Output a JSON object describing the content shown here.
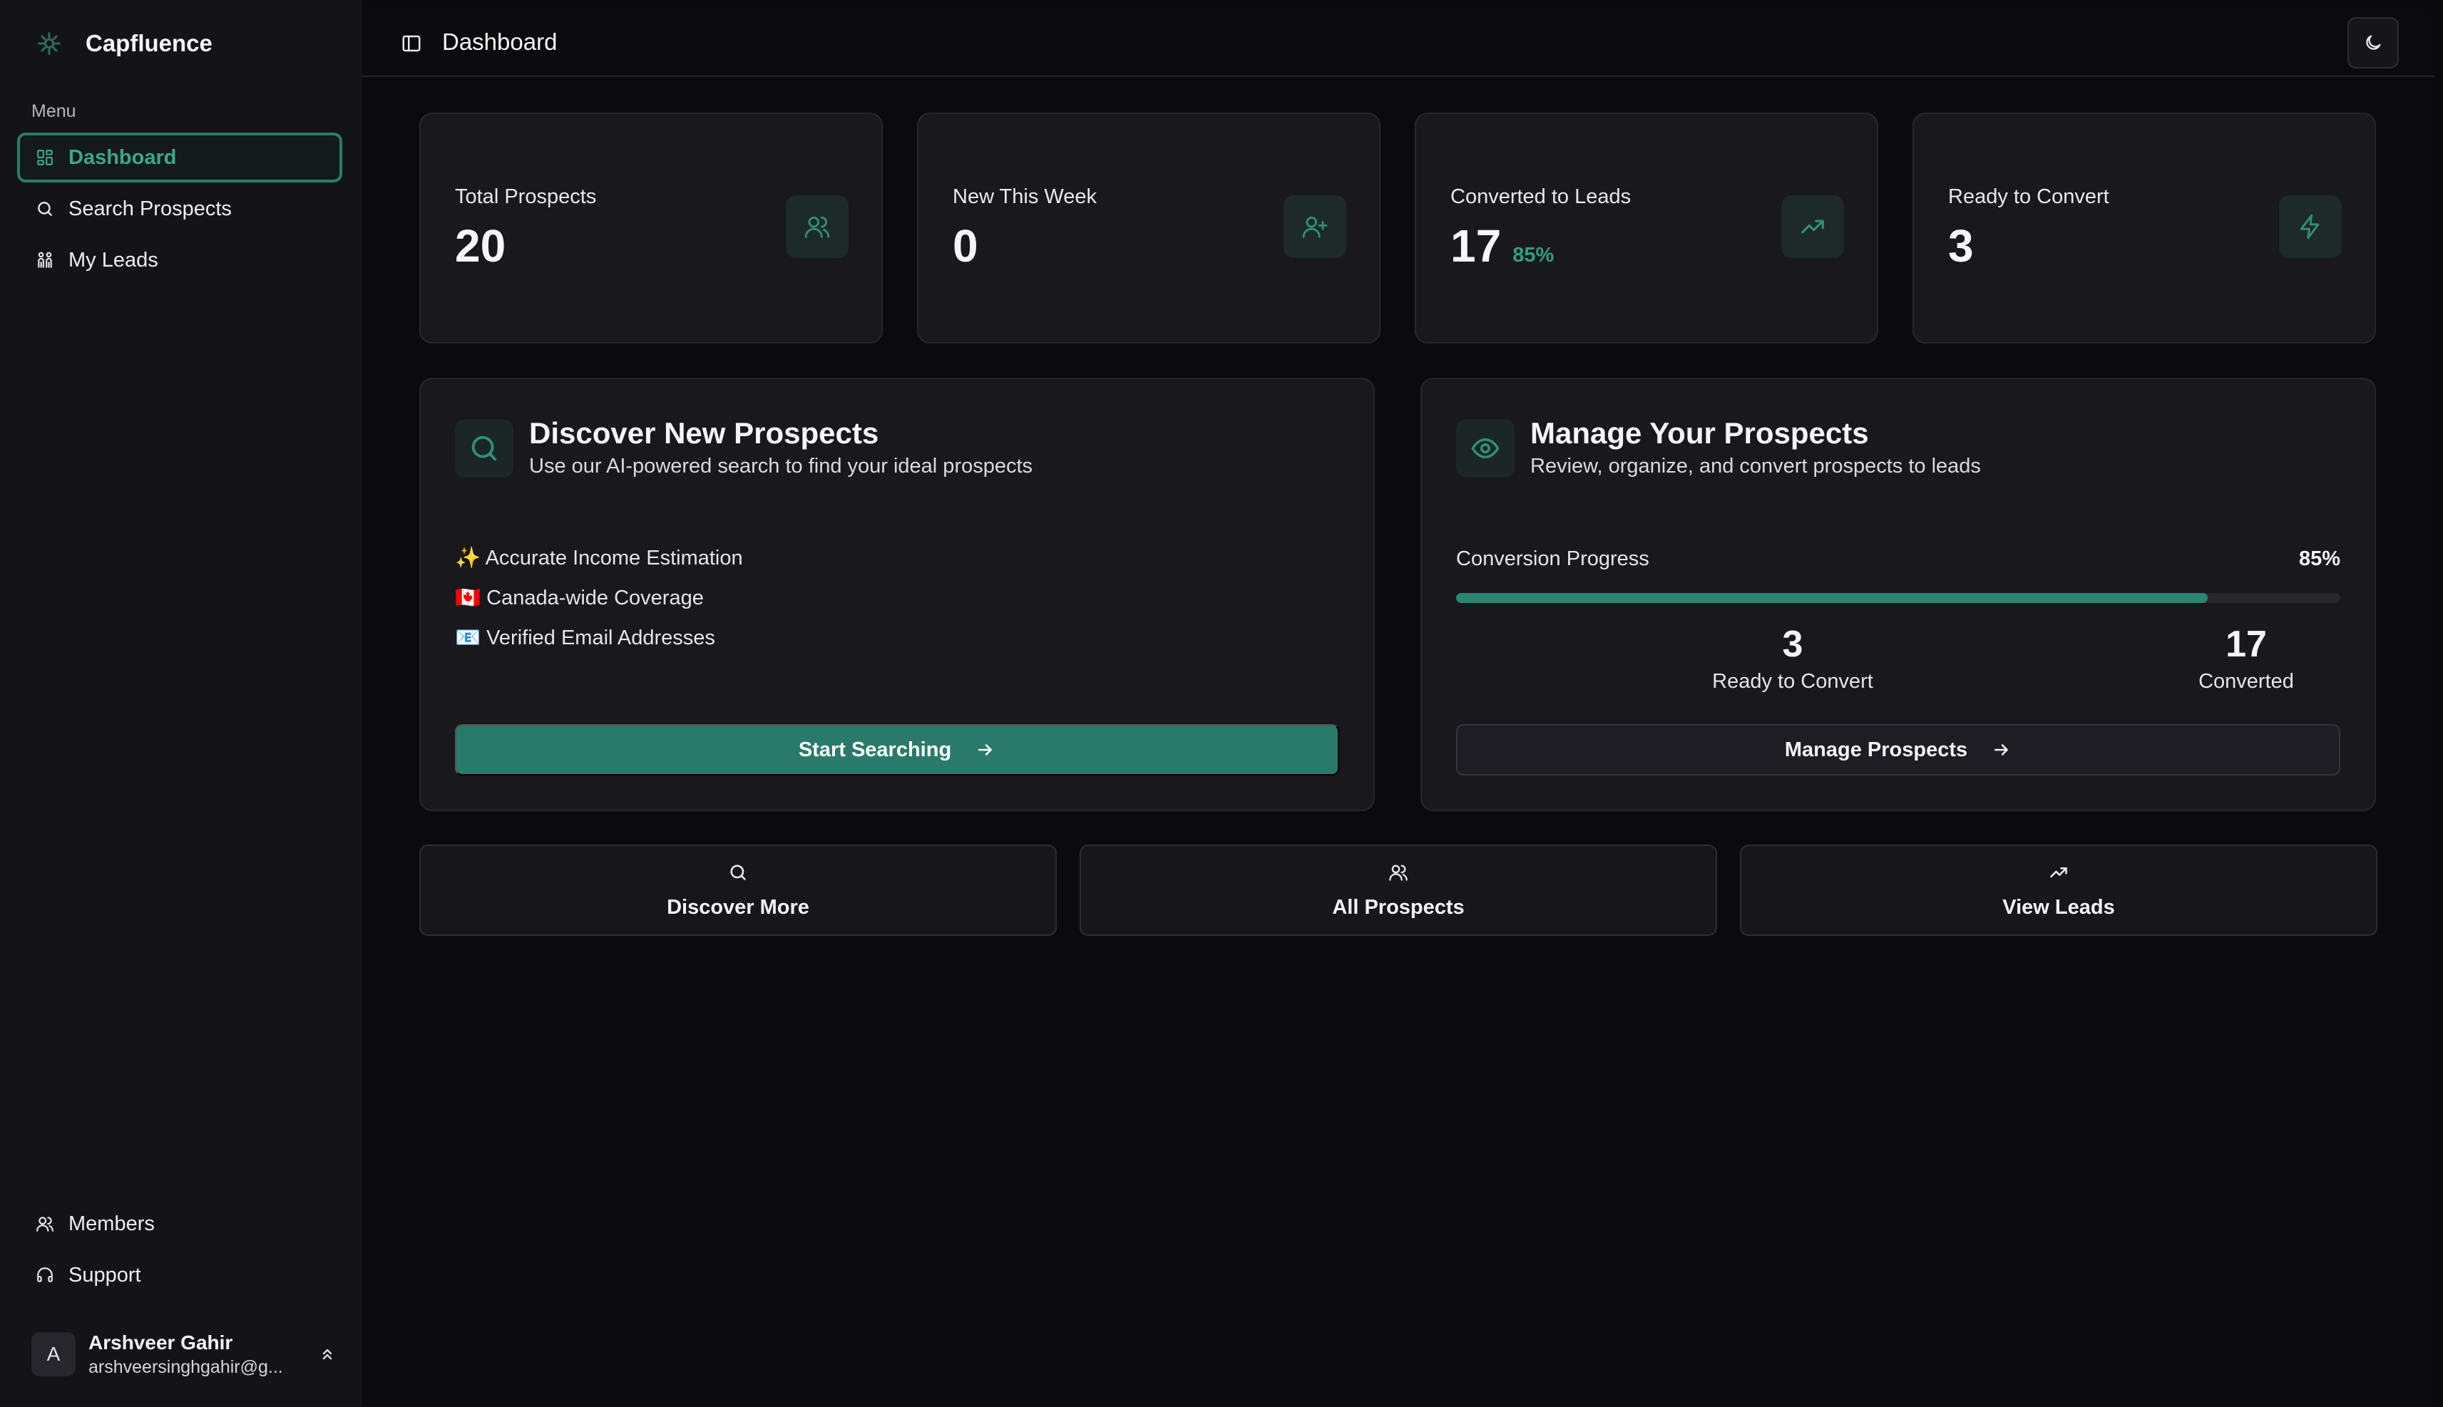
{
  "app": {
    "name": "Capfluence"
  },
  "sidebar": {
    "menu_label": "Menu",
    "items": [
      {
        "label": "Dashboard",
        "icon": "dashboard-icon",
        "active": true
      },
      {
        "label": "Search Prospects",
        "icon": "search-icon",
        "active": false
      },
      {
        "label": "My Leads",
        "icon": "leads-icon",
        "active": false
      }
    ],
    "bottom_items": [
      {
        "label": "Members",
        "icon": "users-icon"
      },
      {
        "label": "Support",
        "icon": "headset-icon"
      }
    ],
    "user": {
      "initial": "A",
      "name": "Arshveer Gahir",
      "email": "arshveersinghgahir@g..."
    }
  },
  "header": {
    "title": "Dashboard"
  },
  "stats": [
    {
      "label": "Total Prospects",
      "value": "20",
      "sub": "",
      "icon": "users-icon"
    },
    {
      "label": "New This Week",
      "value": "0",
      "sub": "",
      "icon": "user-plus-icon"
    },
    {
      "label": "Converted to Leads",
      "value": "17",
      "sub": "85%",
      "icon": "trending-up-icon"
    },
    {
      "label": "Ready to Convert",
      "value": "3",
      "sub": "",
      "icon": "lightning-icon"
    }
  ],
  "discover": {
    "title": "Discover New Prospects",
    "description": "Use our AI-powered search to find your ideal prospects",
    "features": [
      "✨ Accurate Income Estimation",
      "🇨🇦 Canada-wide Coverage",
      "📧 Verified Email Addresses"
    ],
    "button_label": "Start Searching"
  },
  "manage": {
    "title": "Manage Your Prospects",
    "description": "Review, organize, and convert prospects to leads",
    "progress_label": "Conversion Progress",
    "progress_text": "85%",
    "progress_value": 0.85,
    "ready": {
      "value": "3",
      "label": "Ready to Convert"
    },
    "converted": {
      "value": "17",
      "label": "Converted"
    },
    "button_label": "Manage Prospects"
  },
  "quick_actions": [
    {
      "label": "Discover More",
      "icon": "search-icon"
    },
    {
      "label": "All Prospects",
      "icon": "users-icon"
    },
    {
      "label": "View Leads",
      "icon": "trending-up-icon"
    }
  ],
  "colors": {
    "accent": "#2a7a6b",
    "accent_text": "#3aa88c",
    "positive": "#2fa079"
  }
}
